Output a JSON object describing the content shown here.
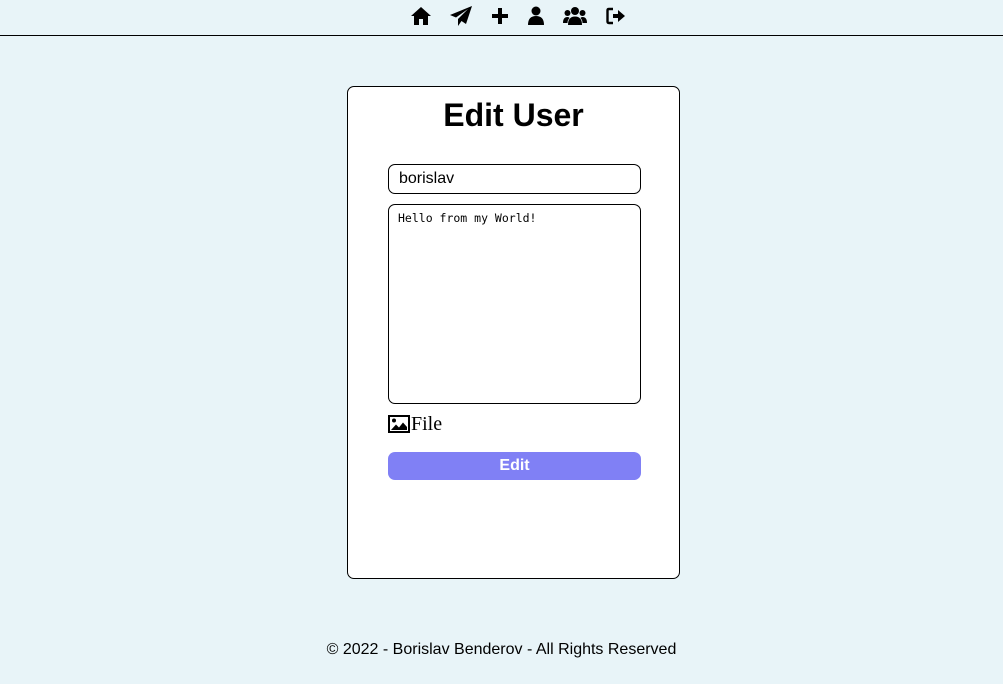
{
  "nav": {
    "icons": [
      "home-icon",
      "send-icon",
      "plus-icon",
      "user-icon",
      "users-icon",
      "sign-out-icon"
    ]
  },
  "form": {
    "title": "Edit User",
    "username_value": "borislav",
    "bio_value": "Hello from my World!",
    "file_label": "File",
    "file_icon": "image-icon",
    "submit_label": "Edit"
  },
  "footer": {
    "text": "© 2022 - Borislav Benderov - All Rights Reserved"
  },
  "colors": {
    "background": "#e8f4f8",
    "card": "#ffffff",
    "button": "#8080f5",
    "button_text": "#ffffff"
  }
}
